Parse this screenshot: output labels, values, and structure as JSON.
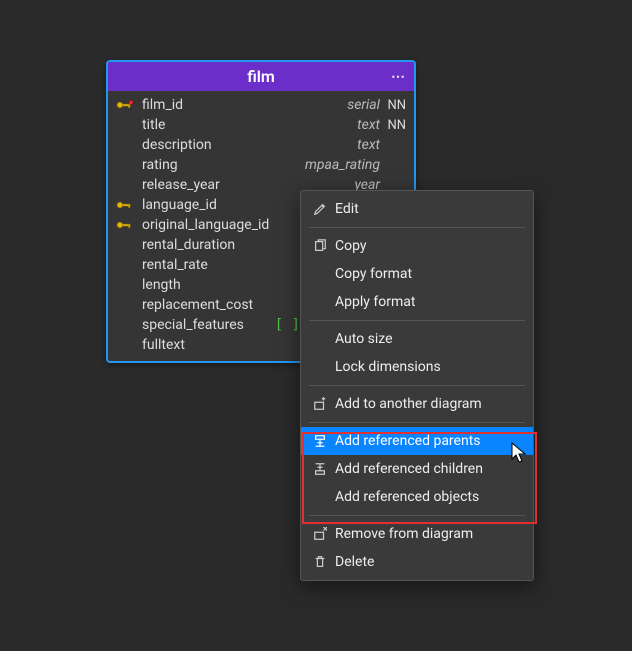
{
  "entity": {
    "title": "film",
    "columns": [
      {
        "key": "pk",
        "name": "film_id",
        "type": "serial",
        "nn": "NN"
      },
      {
        "key": "",
        "name": "title",
        "type": "text",
        "nn": "NN"
      },
      {
        "key": "",
        "name": "description",
        "type": "text",
        "nn": ""
      },
      {
        "key": "",
        "name": "rating",
        "type": "mpaa_rating",
        "nn": ""
      },
      {
        "key": "",
        "name": "release_year",
        "type": "year",
        "nn": ""
      },
      {
        "key": "fk",
        "name": "language_id",
        "type": "",
        "nn": ""
      },
      {
        "key": "fk",
        "name": "original_language_id",
        "type": "",
        "nn": ""
      },
      {
        "key": "",
        "name": "rental_duration",
        "type": "",
        "nn": ""
      },
      {
        "key": "",
        "name": "rental_rate",
        "type": "",
        "nn": ""
      },
      {
        "key": "",
        "name": "length",
        "type": "",
        "nn": ""
      },
      {
        "key": "",
        "name": "replacement_cost",
        "type": "",
        "nn": ""
      },
      {
        "key": "",
        "name": "special_features",
        "type": "",
        "nn": "",
        "suffix": "[ ]"
      },
      {
        "key": "",
        "name": "fulltext",
        "type": "",
        "nn": ""
      }
    ]
  },
  "menu": {
    "edit": "Edit",
    "copy": "Copy",
    "copy_format": "Copy format",
    "apply_format": "Apply format",
    "auto_size": "Auto size",
    "lock_dims": "Lock dimensions",
    "add_diag": "Add to another diagram",
    "add_parents": "Add referenced parents",
    "add_children": "Add referenced children",
    "add_objects": "Add referenced objects",
    "remove": "Remove from diagram",
    "delete": "Delete"
  }
}
